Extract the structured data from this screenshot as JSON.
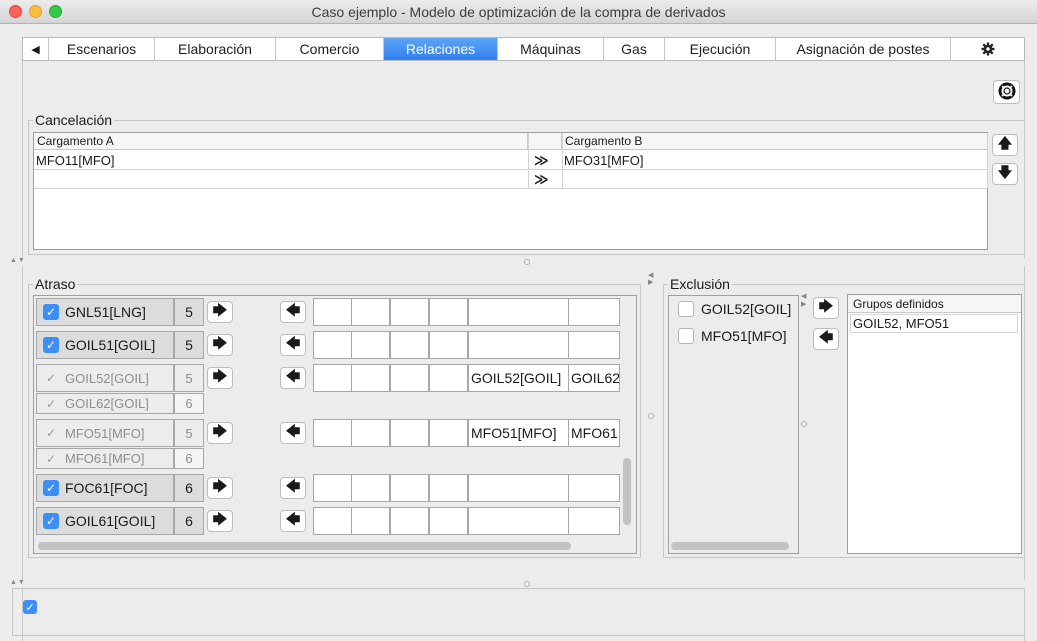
{
  "window": {
    "title": "Caso ejemplo - Modelo de optimización de la compra de derivados"
  },
  "tabs": {
    "scroll_left": "◀",
    "items": [
      "Escenarios",
      "Elaboración",
      "Comercio",
      "Relaciones",
      "Máquinas",
      "Gas",
      "Ejecución",
      "Asignación de postes"
    ],
    "active": "Relaciones",
    "gear_icon": "gear-icon"
  },
  "cancelacion": {
    "title": "Cancelación",
    "columns": [
      "Cargamento A",
      "Cargamento B"
    ],
    "rows": [
      {
        "a": "MFO11[MFO]",
        "link": "≫",
        "b": "MFO31[MFO]"
      },
      {
        "a": "",
        "link": "≫",
        "b": ""
      }
    ],
    "up_icon": "🡅",
    "down_icon": "🡇"
  },
  "atraso": {
    "title": "Atraso",
    "right_arrow": "🡆",
    "left_arrow": "🡄",
    "rows": [
      {
        "label": "GNL51[LNG]",
        "num": "5",
        "checked": true,
        "disabled": false,
        "slot5": "",
        "slot6": ""
      },
      {
        "label": "GOIL51[GOIL]",
        "num": "5",
        "checked": true,
        "disabled": false,
        "slot5": "",
        "slot6": ""
      },
      {
        "label": "GOIL52[GOIL]",
        "num": "5",
        "checked": true,
        "disabled": true,
        "slot5": "GOIL52[GOIL]",
        "slot6": "GOIL62"
      },
      {
        "label": "GOIL62[GOIL]",
        "num": "6",
        "checked": true,
        "disabled": true,
        "child": true
      },
      {
        "label": "MFO51[MFO]",
        "num": "5",
        "checked": true,
        "disabled": true,
        "slot5": "MFO51[MFO]",
        "slot6": "MFO61"
      },
      {
        "label": "MFO61[MFO]",
        "num": "6",
        "checked": true,
        "disabled": true,
        "child": true
      },
      {
        "label": "FOC61[FOC]",
        "num": "6",
        "checked": true,
        "disabled": false,
        "slot5": "",
        "slot6": ""
      },
      {
        "label": "GOIL61[GOIL]",
        "num": "6",
        "checked": true,
        "disabled": false,
        "slot5": "",
        "slot6": ""
      }
    ]
  },
  "exclusion": {
    "title": "Exclusión",
    "items": [
      "GOIL52[GOIL]",
      "MFO51[MFO]"
    ],
    "add_arrow": "🡆",
    "remove_arrow": "🡄",
    "groups_header": "Grupos definidos",
    "groups": [
      "GOIL52, MFO51"
    ]
  },
  "bottom": {
    "checked": true
  }
}
